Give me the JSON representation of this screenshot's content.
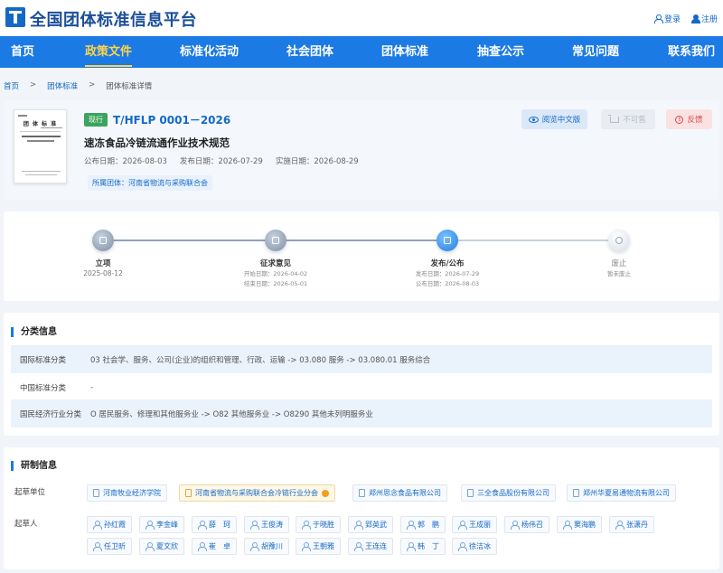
{
  "header": {
    "site_title": "全国团体标准信息平台",
    "login": "登录",
    "register": "注册"
  },
  "nav": [
    "首页",
    "政策文件",
    "标准化活动",
    "社会团体",
    "团体标准",
    "抽查公示",
    "常见问题",
    "联系我们"
  ],
  "nav_active": "政策文件",
  "breadcrumb": {
    "home": "首页",
    "sep": ">",
    "section": "团体标准",
    "current": "团体标准详情"
  },
  "thumbnail": {
    "title": "团 体 标 准"
  },
  "standard": {
    "status": "现行",
    "code": "T/HFLP 0001－2026",
    "name": "速冻食品冷链流通作业技术规范",
    "publish_date": "公布日期：2026-08-03",
    "release_date": "发布日期：2026-07-29",
    "effective_date": "实施日期：2026-08-29",
    "org": "所属团体：河南省物流与采购联合会"
  },
  "actions": {
    "read": "阅览中文版",
    "buy": "不可售",
    "feedback": "反馈"
  },
  "timeline": [
    {
      "label": "立项",
      "line1": "2025-08-12",
      "line2": ""
    },
    {
      "label": "征求意见",
      "line1": "开始日期：2026-04-02",
      "line2": "结束日期：2026-05-01"
    },
    {
      "label": "发布/公布",
      "line1": "发布日期：2026-07-29",
      "line2": "公布日期：2026-08-03"
    },
    {
      "label": "废止",
      "line1": "暂未废止",
      "line2": ""
    }
  ],
  "classification": {
    "title": "分类信息",
    "rows": [
      {
        "key": "国际标准分类",
        "value": "03 社会学、服务、公司(企业)的组织和管理、行政、运输 -> 03.080 服务 -> 03.080.01 服务综合"
      },
      {
        "key": "中国标准分类",
        "value": "-"
      },
      {
        "key": "国民经济行业分类",
        "value": "O 居民服务、修理和其他服务业 -> O82 其他服务业 -> O8290 其他未列明服务业"
      }
    ]
  },
  "development": {
    "title": "研制信息",
    "drafting_units_label": "起草单位",
    "drafting_units": [
      "河南牧业经济学院",
      "河南省物流与采购联合会冷链行业分会",
      "郑州思念食品有限公司",
      "三全食品股份有限公司",
      "郑州华夏易通物流有限公司"
    ],
    "drafters_label": "起草人",
    "drafters": [
      "孙红霞",
      "李金峰",
      "薛　珂",
      "王俊涛",
      "于晓胜",
      "郢英武",
      "郭　鹏",
      "王成丽",
      "杨伟召",
      "窦海鹏",
      "张潇丹",
      "任卫昕",
      "夏文欣",
      "崔　卓",
      "胡豫川",
      "王朝雅",
      "王连连",
      "韩　丁",
      "徐洁冰"
    ]
  }
}
